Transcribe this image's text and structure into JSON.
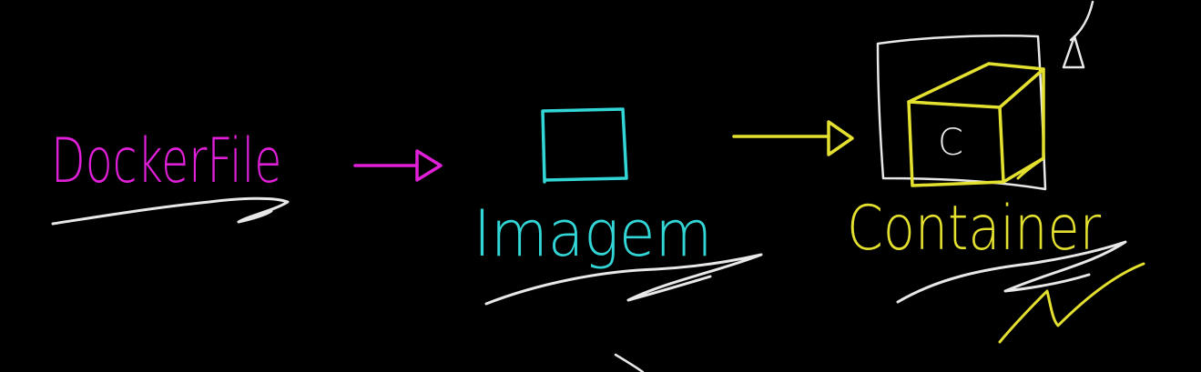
{
  "diagram": {
    "nodes": [
      {
        "id": "dockerfile",
        "label": "DockerFile",
        "color": "#e020d8"
      },
      {
        "id": "imagem",
        "label": "Imagem",
        "color": "#33d6d6"
      },
      {
        "id": "container",
        "label": "Container",
        "color": "#e4e030",
        "box_letter": "C"
      }
    ],
    "edges": [
      {
        "from": "dockerfile",
        "to": "imagem",
        "color": "#e020d8"
      },
      {
        "from": "imagem",
        "to": "container",
        "color": "#e4e030"
      }
    ],
    "underline_colors": {
      "white": "#e8e8e8",
      "yellow": "#e4e030"
    }
  }
}
